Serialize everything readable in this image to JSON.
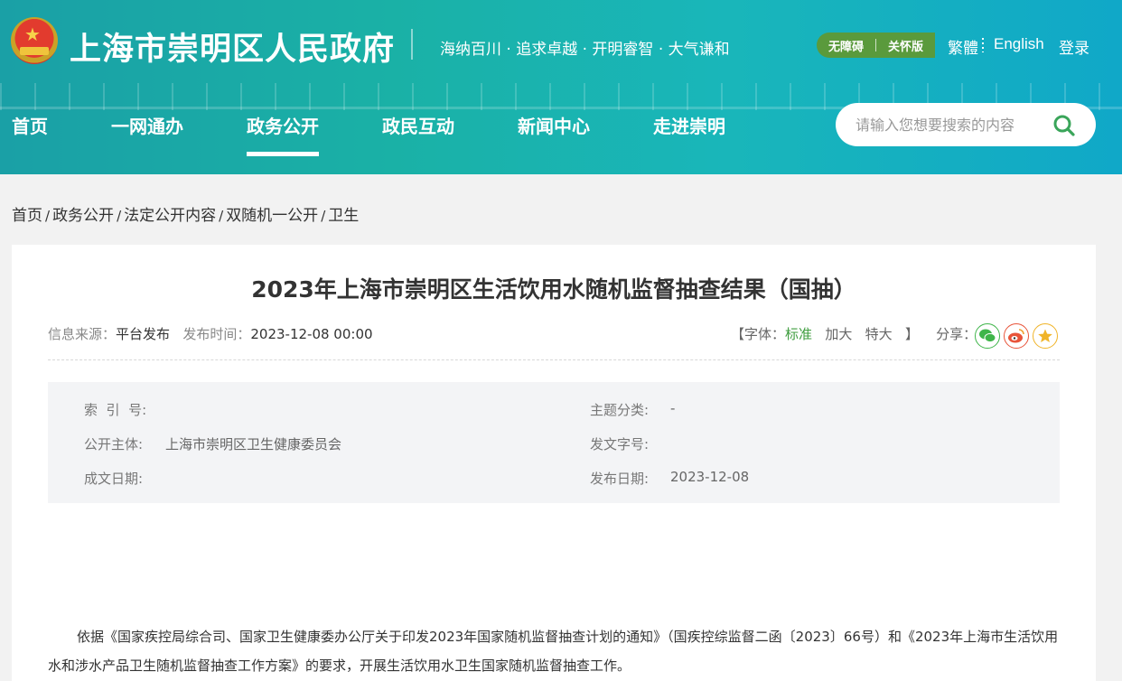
{
  "header": {
    "site_title": "上海市崇明区人民政府",
    "slogan": "海纳百川 · 追求卓越 · 开明睿智 · 大气谦和",
    "accessibility": "无障碍",
    "care_mode": "关怀版",
    "traditional": "繁體",
    "english": "English",
    "login": "登录"
  },
  "nav": {
    "items": [
      "首页",
      "一网通办",
      "政务公开",
      "政民互动",
      "新闻中心",
      "走进崇明"
    ],
    "active": "政务公开"
  },
  "search": {
    "placeholder": "请输入您想要搜索的内容"
  },
  "breadcrumb": [
    "首页",
    "政务公开",
    "法定公开内容",
    "双随机一公开",
    "卫生"
  ],
  "article": {
    "title": "2023年上海市崇明区生活饮用水随机监督抽查结果（国抽）",
    "source_label": "信息来源：",
    "source": "平台发布",
    "time_label": "发布时间：",
    "time": "2023-12-08 00:00",
    "font_label": "【字体：",
    "font_standard": "标准",
    "font_large": "加大",
    "font_xlarge": "特大",
    "font_close": "】",
    "share_label": "分享："
  },
  "info": {
    "index_label": "索  引  号:",
    "index_value": "",
    "topic_label": "主题分类:",
    "topic_value": "-",
    "publisher_label": "公开主体:",
    "publisher_value": "上海市崇明区卫生健康委员会",
    "doc_no_label": "发文字号:",
    "doc_no_value": "",
    "written_date_label": "成文日期:",
    "written_date_value": "",
    "publish_date_label": "发布日期:",
    "publish_date_value": "2023-12-08"
  },
  "body": "依据《国家疾控局综合司、国家卫生健康委办公厅关于印发2023年国家随机监督抽查计划的通知》（国疾控综监督二函〔2023〕66号）和《2023年上海市生活饮用水和涉水产品卫生随机监督抽查工作方案》的要求，开展生活饮用水卫生国家随机监督抽查工作。",
  "colors": {
    "header": "#19b2a8",
    "accent_green": "#3f9d3f",
    "pill": "#5a9a3c"
  }
}
